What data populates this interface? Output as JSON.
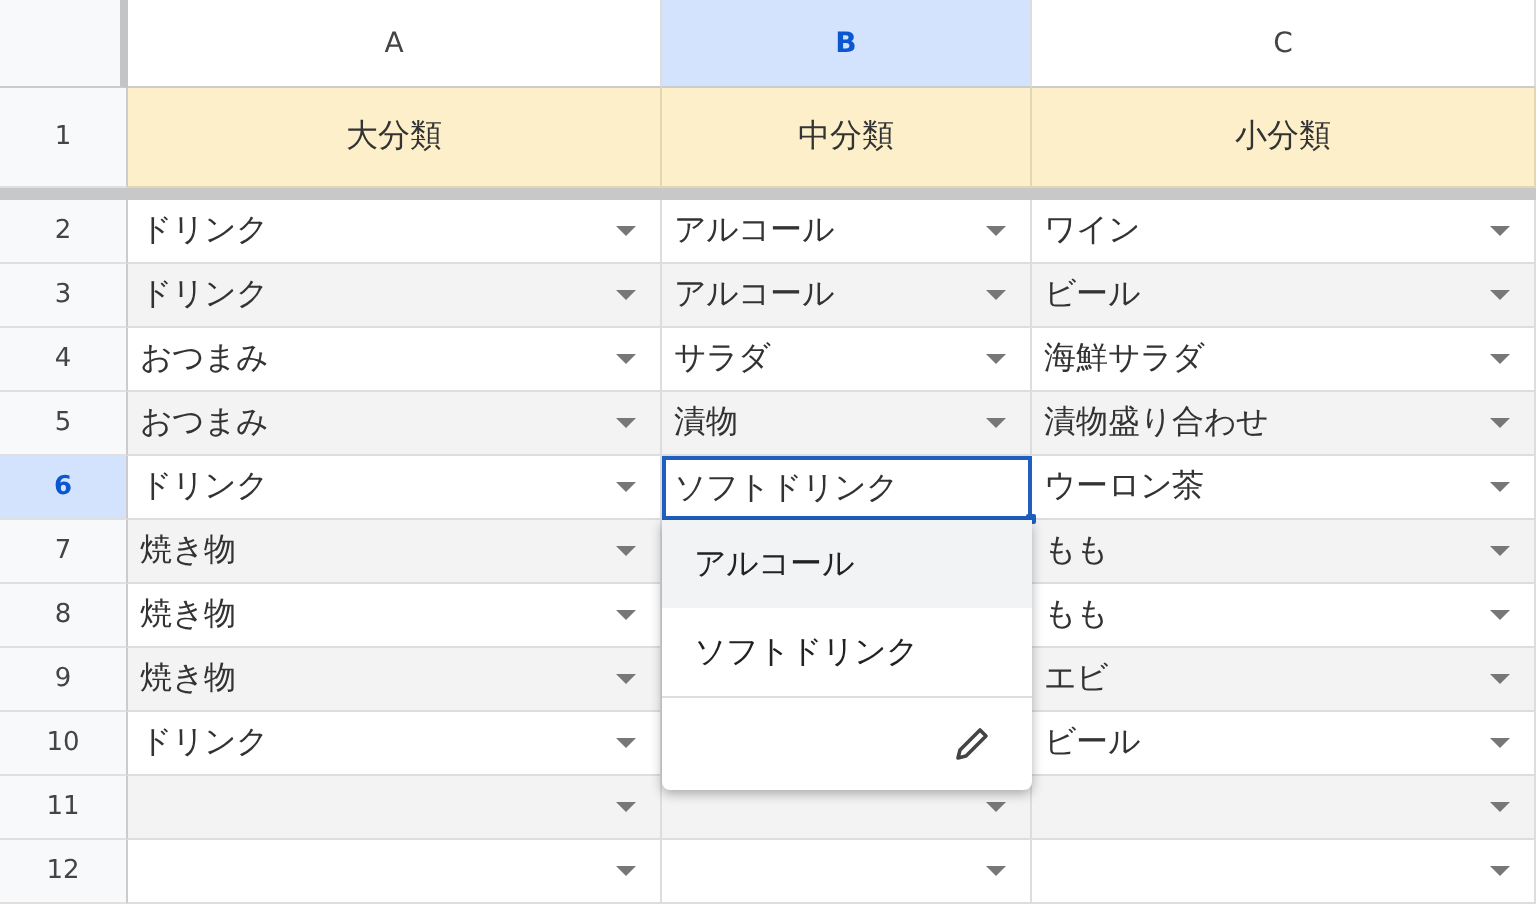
{
  "columns": [
    {
      "label": "A",
      "selected": false
    },
    {
      "label": "B",
      "selected": true
    },
    {
      "label": "C",
      "selected": false
    }
  ],
  "header_row": {
    "number": "1",
    "cells": [
      "大分類",
      "中分類",
      "小分類"
    ]
  },
  "rows": [
    {
      "number": "2",
      "selected": false,
      "cells": [
        {
          "text": "ドリンク"
        },
        {
          "text": "アルコール"
        },
        {
          "text": "ワイン"
        }
      ]
    },
    {
      "number": "3",
      "selected": false,
      "cells": [
        {
          "text": "ドリンク"
        },
        {
          "text": "アルコール"
        },
        {
          "text": "ビール"
        }
      ]
    },
    {
      "number": "4",
      "selected": false,
      "cells": [
        {
          "text": "おつまみ"
        },
        {
          "text": "サラダ"
        },
        {
          "text": "海鮮サラダ"
        }
      ]
    },
    {
      "number": "5",
      "selected": false,
      "cells": [
        {
          "text": "おつまみ"
        },
        {
          "text": "漬物"
        },
        {
          "text": "漬物盛り合わせ"
        }
      ]
    },
    {
      "number": "6",
      "selected": true,
      "cells": [
        {
          "text": "ドリンク"
        },
        {
          "text": "ソフトドリンク",
          "editing": true
        },
        {
          "text": "ウーロン茶"
        }
      ]
    },
    {
      "number": "7",
      "selected": false,
      "cells": [
        {
          "text": "焼き物"
        },
        null,
        {
          "text": "もも"
        }
      ]
    },
    {
      "number": "8",
      "selected": false,
      "cells": [
        {
          "text": "焼き物"
        },
        null,
        {
          "text": "もも"
        }
      ]
    },
    {
      "number": "9",
      "selected": false,
      "cells": [
        {
          "text": "焼き物"
        },
        null,
        {
          "text": "エビ"
        }
      ]
    },
    {
      "number": "10",
      "selected": false,
      "cells": [
        {
          "text": "ドリンク"
        },
        null,
        {
          "text": "ビール"
        }
      ]
    },
    {
      "number": "11",
      "selected": false,
      "cells": [
        {},
        {},
        {}
      ]
    },
    {
      "number": "12",
      "selected": false,
      "cells": [
        {},
        {},
        {}
      ]
    }
  ],
  "dropdown": {
    "options": [
      {
        "label": "アルコール",
        "highlighted": true
      },
      {
        "label": "ソフトドリンク",
        "highlighted": false
      }
    ]
  }
}
